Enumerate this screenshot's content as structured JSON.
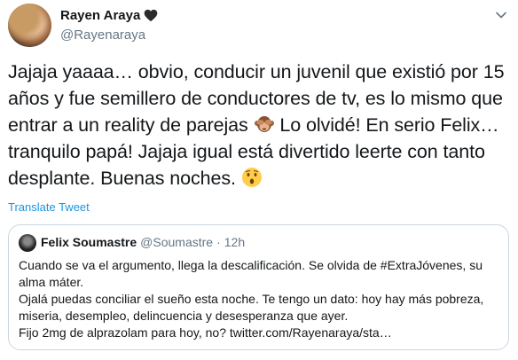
{
  "author": {
    "display_name": "Rayen Araya",
    "handle": "@Rayenaraya"
  },
  "tweet": {
    "text_part1": "Jajaja yaaaa… obvio, conducir un juvenil que existió por 15 años y fue semillero de conductores de tv, es lo mismo que entrar a un reality de parejas ",
    "emoji1": "see-no-evil-monkey-icon",
    "text_part2": " Lo olvidé! En serio Felix… tranquilo papá! Jajaja igual está divertido leerte con tanto desplante. Buenas noches. ",
    "emoji2": "hushed-face-icon",
    "translate_label": "Translate Tweet"
  },
  "quoted": {
    "display_name": "Felix Soumastre",
    "handle": "@Soumastre",
    "separator": "·",
    "time": "12h",
    "para1": "Cuando se va el argumento, llega la descalificación. Se olvida de #ExtraJóvenes, su alma máter.",
    "para2": "Ojalá puedas conciliar el sueño esta noche. Te tengo un dato: hoy hay más pobreza, miseria, desempleo, delincuencia y desesperanza que ayer.",
    "para3": "Fijo 2mg de alprazolam para hoy, no? twitter.com/Rayenaraya/sta…"
  },
  "colors": {
    "link": "#1b95e0",
    "muted": "#657786",
    "border": "#ccd6dd"
  }
}
